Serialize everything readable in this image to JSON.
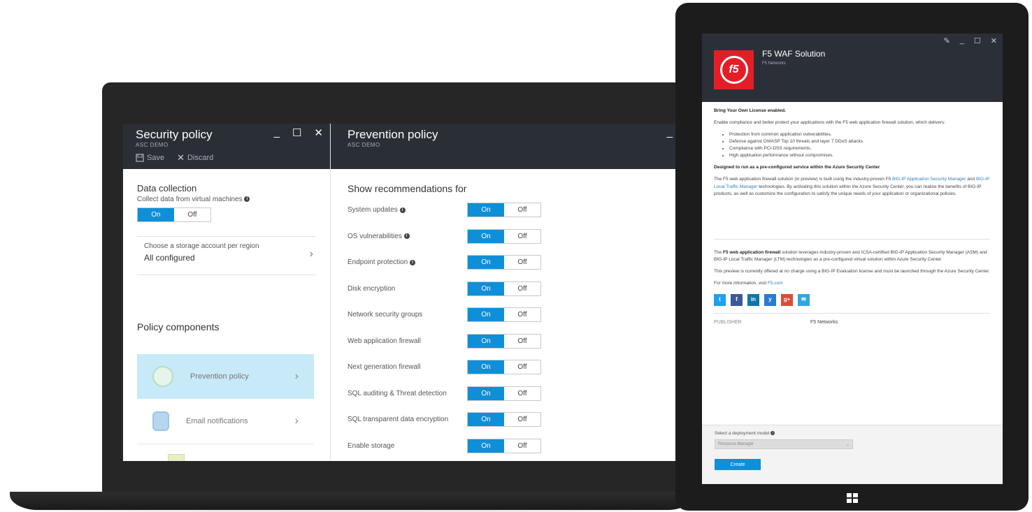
{
  "security_blade": {
    "title": "Security policy",
    "subtitle": "ASC DEMO",
    "toolbar": {
      "save_label": "Save",
      "discard_label": "Discard"
    },
    "controls": {
      "minimize": "_",
      "maximize": "☐",
      "close": "✕"
    },
    "data_collection": {
      "title": "Data collection",
      "description": "Collect data from virtual machines",
      "toggle": {
        "on": "On",
        "off": "Off",
        "selected": "On"
      }
    },
    "storage": {
      "label": "Choose a storage account per region",
      "value": "All configured"
    },
    "policy_components": {
      "title": "Policy components",
      "items": [
        {
          "label": "Prevention policy",
          "icon": "gauge-icon",
          "active": true
        },
        {
          "label": "Email notifications",
          "icon": "mail-icon",
          "active": false
        }
      ]
    }
  },
  "prevention_blade": {
    "title": "Prevention policy",
    "subtitle": "ASC DEMO",
    "section_title": "Show recommendations for",
    "rows": [
      {
        "label": "System updates",
        "info": true,
        "on": "On",
        "off": "Off"
      },
      {
        "label": "OS vulnerabilities",
        "info": true,
        "on": "On",
        "off": "Off"
      },
      {
        "label": "Endpoint protection",
        "info": true,
        "on": "On",
        "off": "Off"
      },
      {
        "label": "Disk encryption",
        "info": false,
        "on": "On",
        "off": "Off"
      },
      {
        "label": "Network security groups",
        "info": false,
        "on": "On",
        "off": "Off"
      },
      {
        "label": "Web application firewall",
        "info": false,
        "on": "On",
        "off": "Off"
      },
      {
        "label": "Next generation firewall",
        "info": false,
        "on": "On",
        "off": "Off"
      },
      {
        "label": "SQL auditing & Threat detection",
        "info": false,
        "on": "On",
        "off": "Off"
      },
      {
        "label": "SQL transparent data encryption",
        "info": false,
        "on": "On",
        "off": "Off"
      },
      {
        "label": "Enable storage",
        "info": false,
        "on": "On",
        "off": "Off"
      }
    ]
  },
  "tablet": {
    "controls": {
      "pin": "✎",
      "minimize": "_",
      "maximize": "☐",
      "close": "✕"
    },
    "app_title": "F5 WAF Solution",
    "publisher_sub": "F5 Networks",
    "logo_text": "f5",
    "byol": "Bring Your Own License enabled.",
    "intro": "Enable compliance and better protect your applications with the F5 web application firewall solution, which delivers:",
    "bullets": [
      "Protection from common application vulnerabilities.",
      "Defense against OWASP Top 10 threats and layer 7 DDoS attacks.",
      "Compliance with PCI-DSS requirements.",
      "High application performance without compromises."
    ],
    "designed": "Designed to run as a pre-configured service within the Azure Security Center",
    "para1_a": "The F5 web application firewall solution (in preview) is built using the industry-proven F5 ",
    "para1_link1": "BIG-IP Application Security Manager",
    "para1_b": " and ",
    "para1_link2": "BIG-IP Local Traffic Manager",
    "para1_c": " technologies. By activating this solution within the Azure Security Center, you can realize the benefits of BIG-IP products, as well as customize the configuration to satisfy the unique needs of your application or organizational policies.",
    "para2_a": "The ",
    "para2_bold": "F5 web application firewall",
    "para2_b": " solution leverages industry-proven and ICSA-certified BIG-IP Application Security Manager (ASM) and BIG-IP Local Traffic Manager (LTM) technologies as a pre-configured virtual solution within Azure Security Center.",
    "para3": "This preview is currently offered at no charge using a BIG-IP Evaluation license and must be launched through the Azure Security Center.",
    "more_info": "For more information, visit ",
    "more_info_link": "F5.com",
    "social": [
      {
        "icon": "twitter-icon",
        "glyph": "t",
        "color": "#1da1f2"
      },
      {
        "icon": "facebook-icon",
        "glyph": "f",
        "color": "#3b5998"
      },
      {
        "icon": "linkedin-icon",
        "glyph": "in",
        "color": "#0e76a8"
      },
      {
        "icon": "yammer-icon",
        "glyph": "y",
        "color": "#2a7bd0"
      },
      {
        "icon": "googleplus-icon",
        "glyph": "g+",
        "color": "#dd4b39"
      },
      {
        "icon": "email-icon",
        "glyph": "✉",
        "color": "#2fa7df"
      }
    ],
    "publisher_key": "PUBLISHER",
    "publisher_val": "F5 Networks",
    "deploy_label": "Select a deployment model",
    "deploy_value": "Resource Manager",
    "create_label": "Create"
  }
}
